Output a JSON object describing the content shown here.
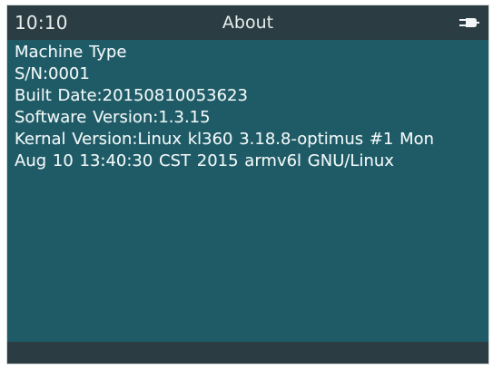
{
  "status_bar": {
    "time": "10:10",
    "title": "About",
    "power_icon": "plug-icon"
  },
  "about": {
    "lines": [
      "Machine Type",
      "S/N:0001",
      "Built Date:20150810053623",
      "Software Version:1.3.15",
      "Kernal Version:Linux kl360 3.18.8-optimus #1 Mon",
      "Aug 10 13:40:30 CST 2015 armv6l GNU/Linux"
    ]
  },
  "colors": {
    "background": "#1f5b66",
    "bar": "#2b3d42",
    "text": "#eef6f7"
  }
}
